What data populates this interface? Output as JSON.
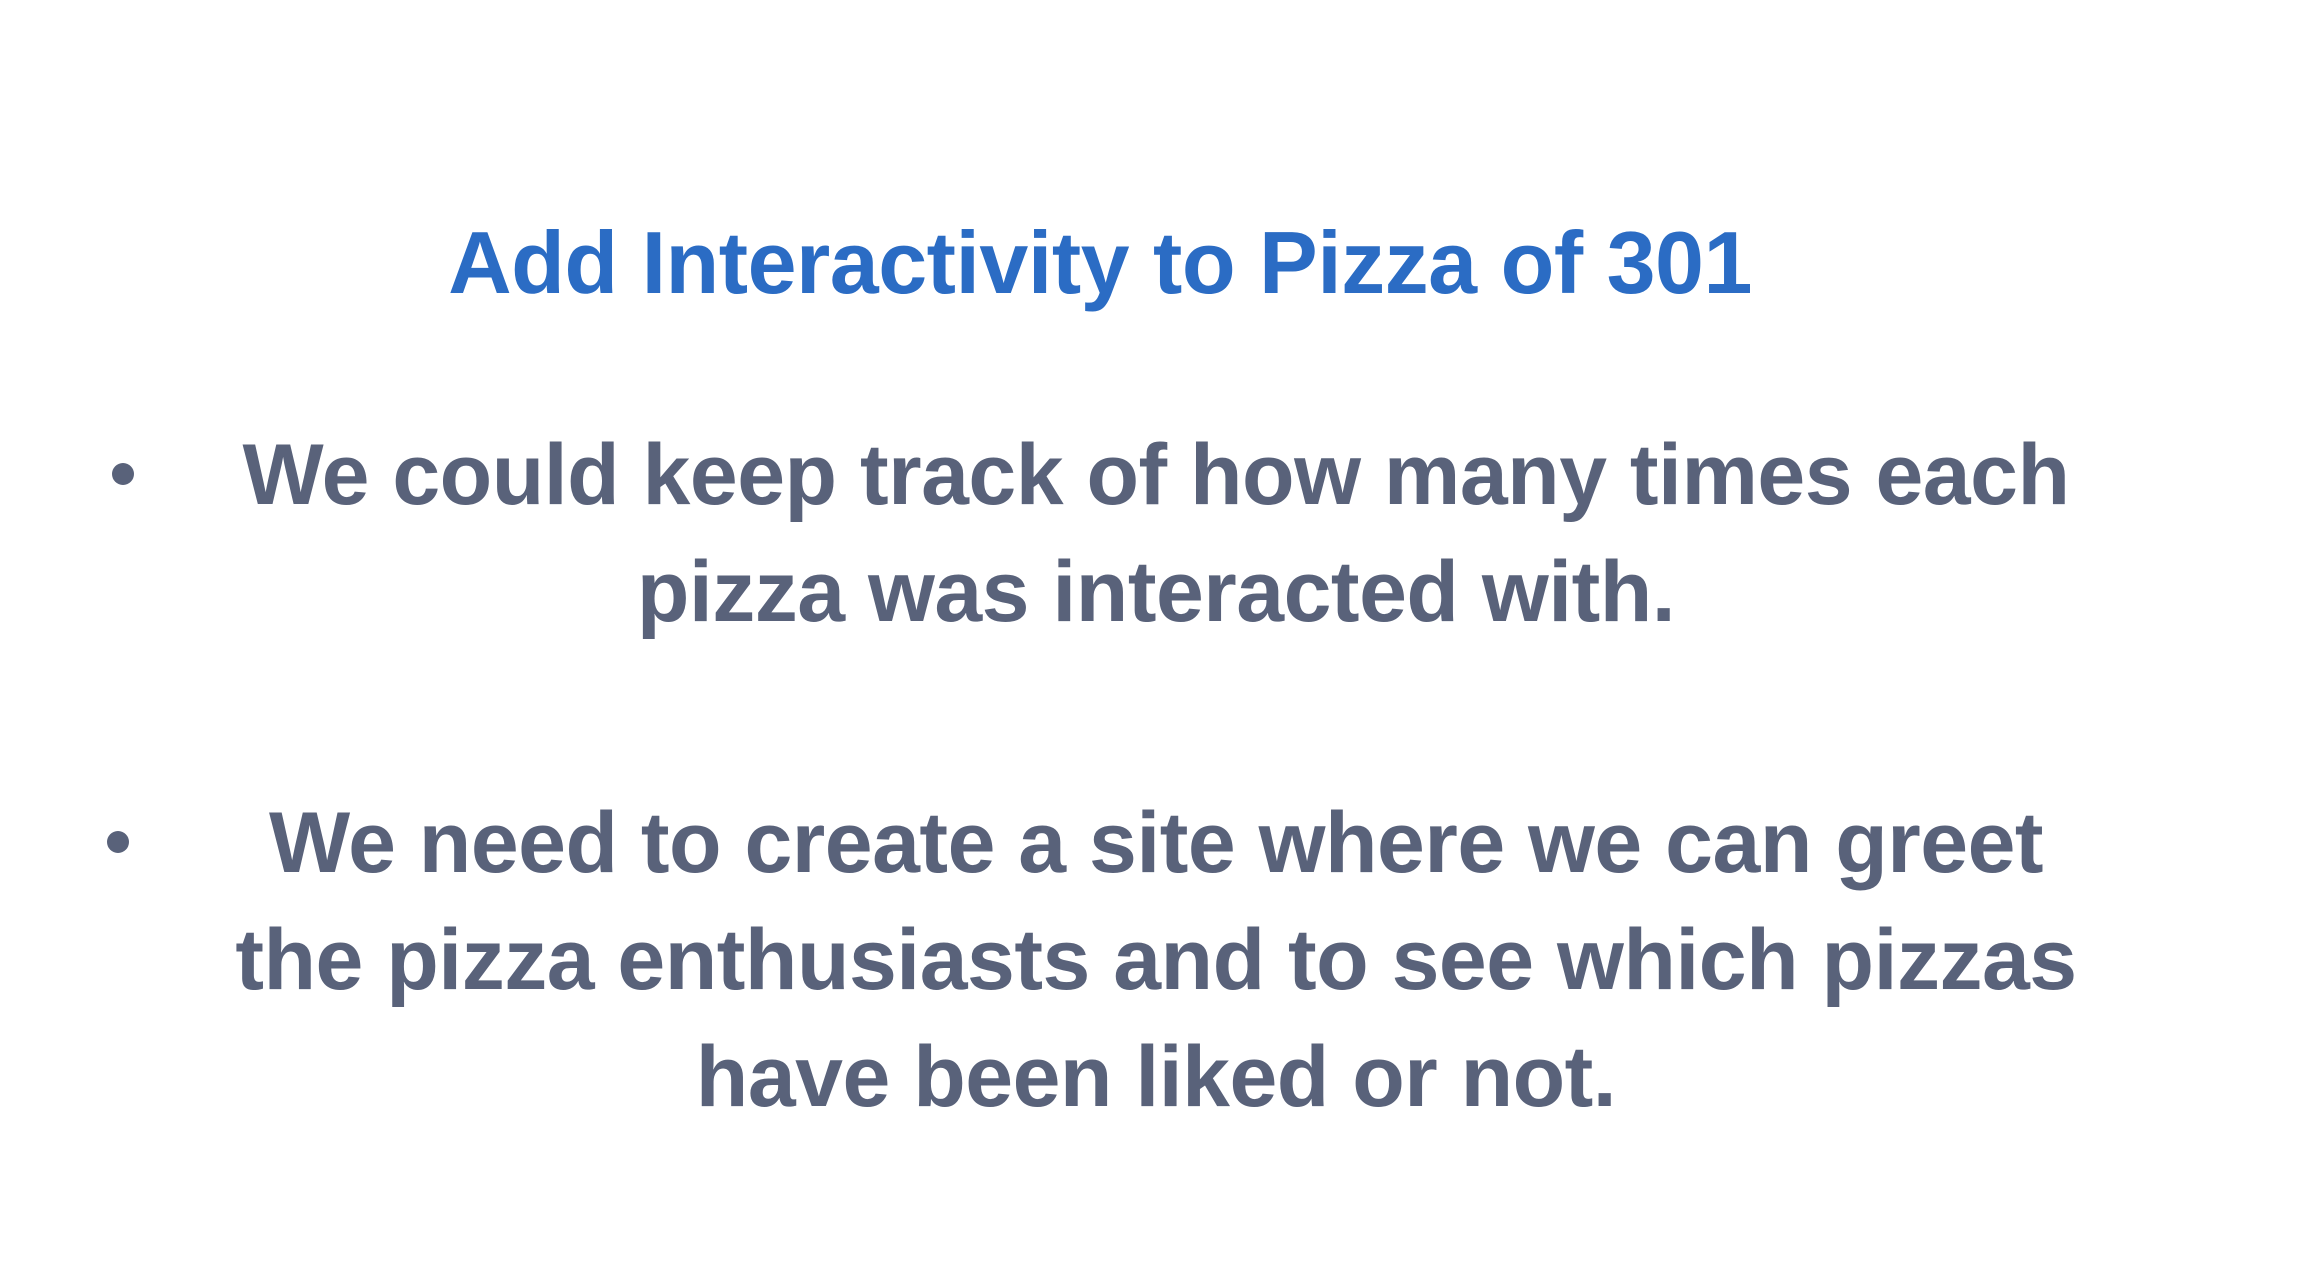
{
  "slide": {
    "title": "Add Interactivity to Pizza of 301",
    "bullets": [
      {
        "lines": [
          "We could keep track of how many times each",
          "pizza was interacted with."
        ]
      },
      {
        "lines": [
          "We need to create a site where we can greet",
          "the pizza enthusiasts and to see which pizzas",
          "have been liked or not."
        ]
      }
    ],
    "colors": {
      "title": "#2b6cc4",
      "body": "#59627a",
      "background": "#ffffff"
    }
  }
}
